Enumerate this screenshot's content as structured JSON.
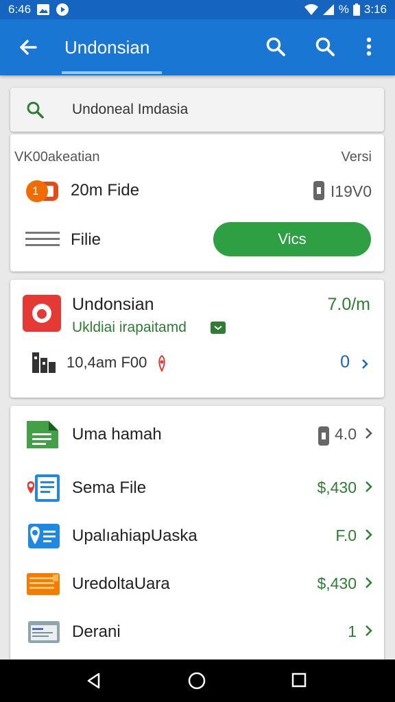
{
  "status_bar": {
    "time_left": "6:46",
    "time_right": "3:16",
    "signal_text": "%"
  },
  "app_bar": {
    "title": "Undonsian"
  },
  "search": {
    "text": "Undoneal Imdasia"
  },
  "card1": {
    "header_left": "VK00akeatian",
    "header_right": "Versi",
    "row1_badge": "1",
    "row1_label": "20m Fide",
    "row1_value": "I19V0",
    "row2_label": "Filie",
    "button_label": "Vics"
  },
  "card2": {
    "title": "Undonsian",
    "subtitle": "Ukldiai irapaitamd",
    "value": "7.0/m",
    "row_label": "10,4am F00",
    "row_value": "0"
  },
  "list": [
    {
      "label": "Uma hamah",
      "value": "4.0",
      "value_color": "#555555",
      "icon": "document-green-icon"
    },
    {
      "label": "Sema File",
      "value": "$,430",
      "value_color": "#2e7d32",
      "icon": "document-location-icon"
    },
    {
      "label": "UpalıahiapUaska",
      "value": "F.0",
      "value_color": "#2e7d32",
      "icon": "location-card-icon"
    },
    {
      "label": "UredoltaUara",
      "value": "$,430",
      "value_color": "#2e7d32",
      "icon": "orange-card-icon"
    },
    {
      "label": "Derani",
      "value": "1",
      "value_color": "#2e7d32",
      "icon": "calendar-card-icon"
    }
  ],
  "colors": {
    "primary": "#1976d2",
    "accent_green": "#2ea043",
    "danger": "#e53935"
  }
}
